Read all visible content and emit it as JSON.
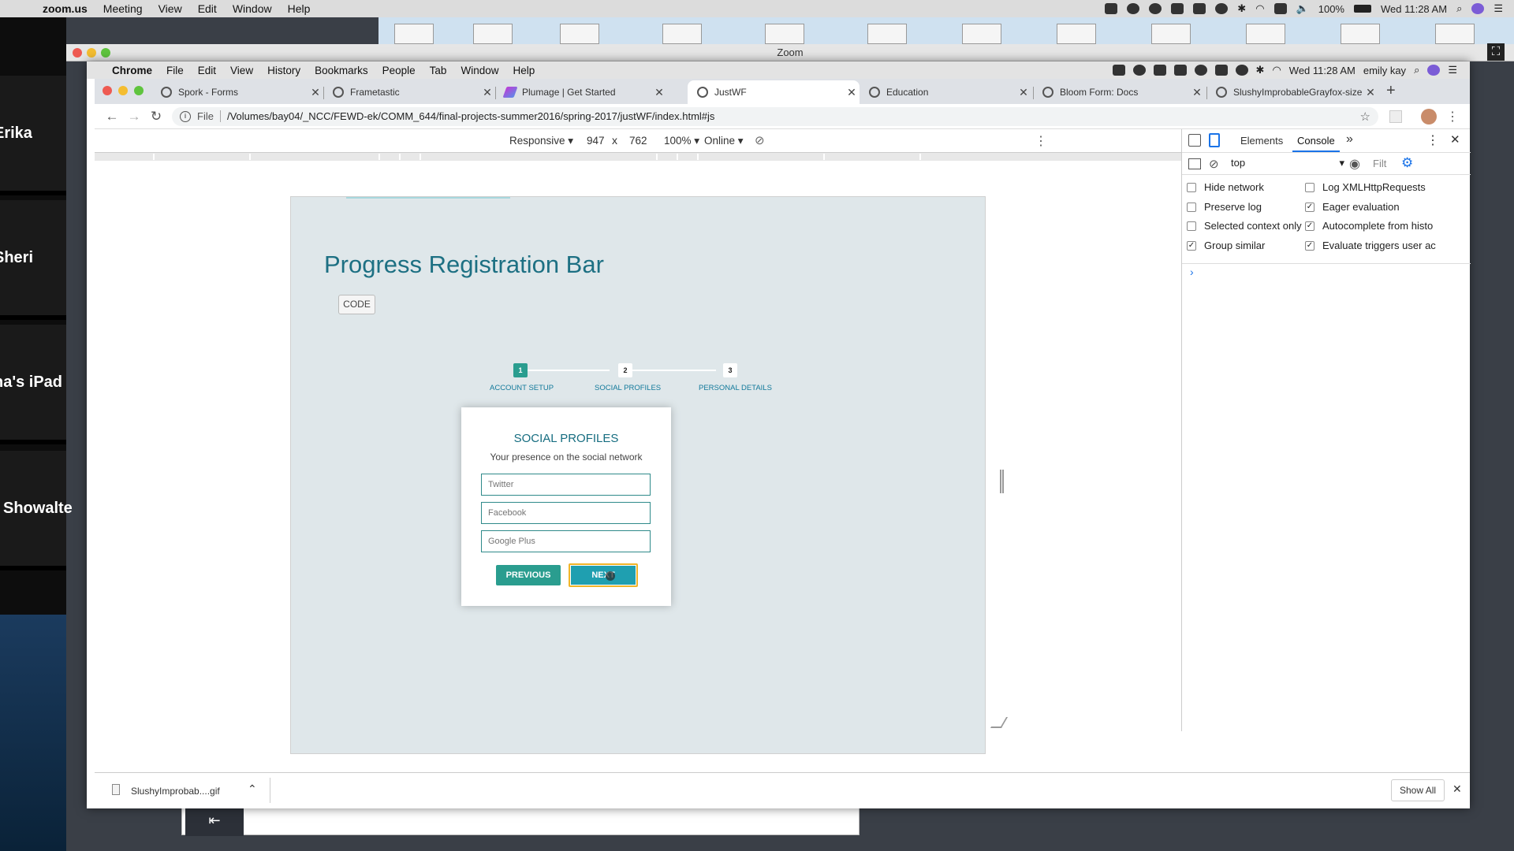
{
  "mac_menubar": {
    "app": "zoom.us",
    "items": [
      "Meeting",
      "View",
      "Edit",
      "Window",
      "Help"
    ],
    "battery": "100%",
    "clock": "Wed 11:28 AM"
  },
  "zoom_window": {
    "title": "Zoom"
  },
  "participants": [
    "Erika",
    "Sheri",
    "na's iPad",
    "Showalte"
  ],
  "chrome_menu": {
    "app": "Chrome",
    "items": [
      "File",
      "Edit",
      "View",
      "History",
      "Bookmarks",
      "People",
      "Tab",
      "Window",
      "Help"
    ],
    "clock": "Wed 11:28 AM",
    "user": "emily kay"
  },
  "tabs": [
    {
      "title": "Spork - Forms",
      "icon": "globe-icon"
    },
    {
      "title": "Frametastic",
      "icon": "globe-icon"
    },
    {
      "title": "Plumage | Get Started",
      "icon": "plumage-icon"
    },
    {
      "title": "JustWF",
      "icon": "globe-icon",
      "active": true
    },
    {
      "title": "Education",
      "icon": "globe-icon"
    },
    {
      "title": "Bloom Form: Docs",
      "icon": "globe-icon"
    },
    {
      "title": "SlushyImprobableGrayfox-size",
      "icon": "globe-icon"
    }
  ],
  "address_bar": {
    "scheme_label": "File",
    "url": "/Volumes/bay04/_NCC/FEWD-ek/COMM_644/final-projects-summer2016/spring-2017/justWF/index.html#js"
  },
  "device_toolbar": {
    "mode": "Responsive",
    "width": "947",
    "times": "x",
    "height": "762",
    "zoom": "100%",
    "network": "Online"
  },
  "page": {
    "title": "Progress Registration Bar",
    "code_button": "CODE",
    "steps": [
      {
        "number": "1",
        "label": "ACCOUNT SETUP",
        "active": true
      },
      {
        "number": "2",
        "label": "SOCIAL PROFILES",
        "active": false
      },
      {
        "number": "3",
        "label": "PERSONAL DETAILS",
        "active": false
      }
    ],
    "card": {
      "heading": "SOCIAL PROFILES",
      "subheading": "Your presence on the social network",
      "fields": [
        {
          "placeholder": "Twitter"
        },
        {
          "placeholder": "Facebook"
        },
        {
          "placeholder": "Google Plus"
        }
      ],
      "previous_label": "PREVIOUS",
      "next_label": "NEXT"
    }
  },
  "devtools": {
    "tabs": [
      "Elements",
      "Console"
    ],
    "active_tab": "Console",
    "more": "»",
    "context": "top",
    "filter_placeholder": "Filt",
    "prompt": "›",
    "settings": [
      {
        "label": "Hide network",
        "checked": false
      },
      {
        "label": "Log XMLHttpRequests",
        "checked": false
      },
      {
        "label": "Preserve log",
        "checked": false
      },
      {
        "label": "Eager evaluation",
        "checked": true
      },
      {
        "label": "Selected context only",
        "checked": false
      },
      {
        "label": "Autocomplete from histo",
        "checked": true
      },
      {
        "label": "Group similar",
        "checked": true
      },
      {
        "label": "Evaluate triggers user ac",
        "checked": true
      }
    ]
  },
  "download_bar": {
    "file": "SlushyImprobab....gif",
    "show_all": "Show All"
  },
  "colors": {
    "accent_teal": "#2a9d8f",
    "next_button": "#1f9fb0",
    "next_focus_outline": "#f0b429",
    "title_teal": "#1d7083",
    "page_bg": "#dfe7ea"
  }
}
